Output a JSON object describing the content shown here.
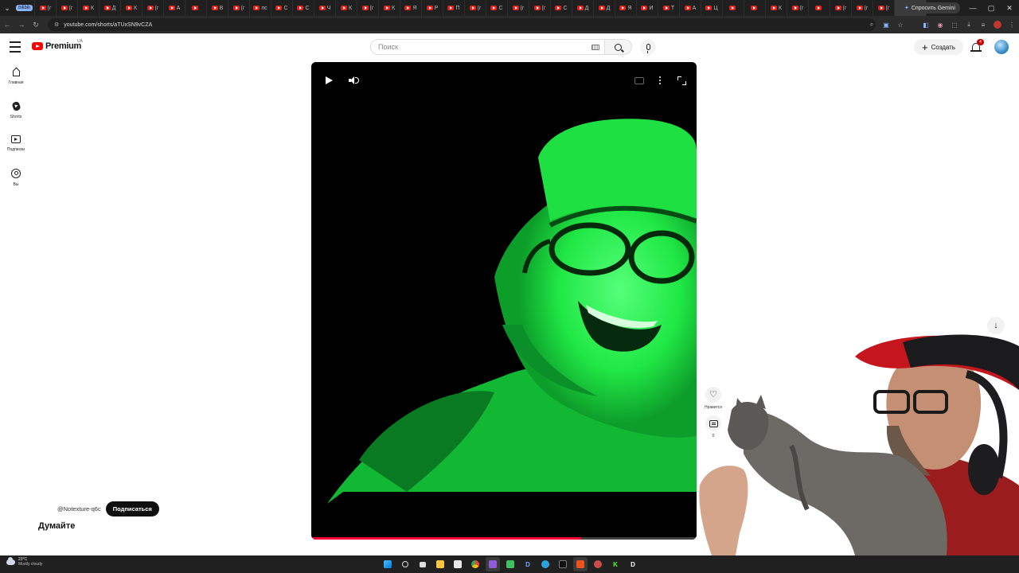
{
  "browser": {
    "tab_labels": [
      "bilibili",
      "(г",
      "(г",
      "К",
      "Д",
      "К",
      "(г",
      "А",
      "",
      "В",
      "(г",
      "пс",
      "С",
      "С",
      "Ч",
      "К",
      "(г",
      "К",
      "Я",
      "Р",
      "П",
      "(г",
      "С",
      "(г",
      "(г",
      "С",
      "Д",
      "Д",
      "Я",
      "И",
      "Т",
      "А",
      "Ц",
      "",
      "",
      "К",
      "(г",
      "",
      "(г",
      "(г",
      "(г"
    ],
    "active_tab_label": "(г",
    "new_tab": "+",
    "gemini_label": "Спросить Gemini",
    "url": "youtube.com/shorts/aTUxSN9vCZA",
    "window_controls": [
      "—",
      "▢",
      "✕"
    ]
  },
  "youtube": {
    "logo_text": "Premium",
    "logo_region": "UA",
    "search_placeholder": "Поиск",
    "create_label": "Создать",
    "notification_count": "4",
    "sidebar": [
      {
        "label": "Главная",
        "icon": "home-icon"
      },
      {
        "label": "Shorts",
        "icon": "shorts-icon"
      },
      {
        "label": "Подписки",
        "icon": "subscriptions-icon"
      },
      {
        "label": "Вы",
        "icon": "you-icon"
      }
    ],
    "short": {
      "channel_handle": "@Notexture-q6c",
      "subscribe_label": "Подписаться",
      "title": "Думайте",
      "like_label": "Нравится",
      "comment_count": "0",
      "progress": 0.7
    },
    "colors": {
      "brand_red": "#ff0000",
      "progress_red": "#ff0033",
      "video_green": "#22ff44"
    }
  },
  "taskbar": {
    "temperature": "23°C",
    "condition": "Mostly cloudy"
  }
}
